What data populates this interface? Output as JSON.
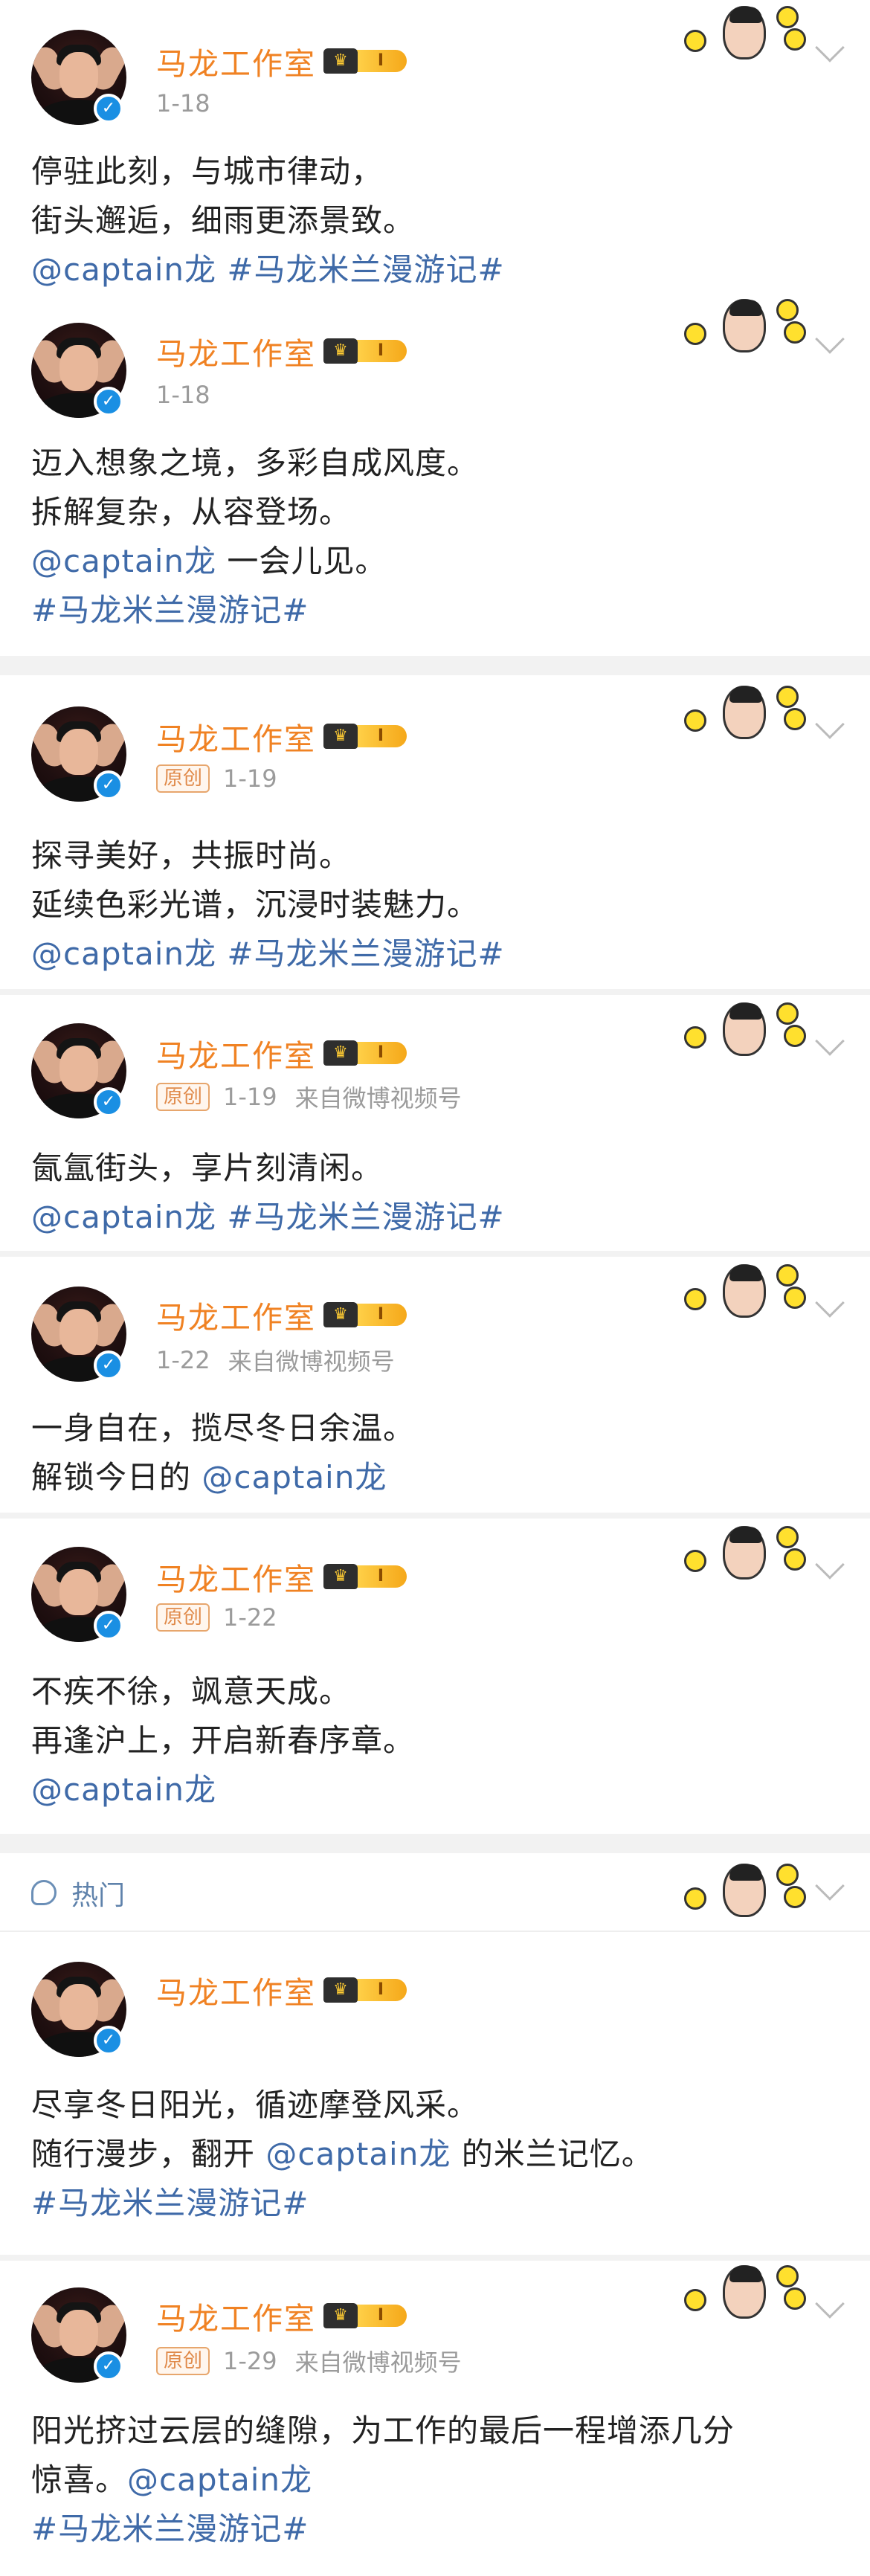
{
  "account": {
    "name": "马龙工作室",
    "vip_level": "Ⅰ",
    "verified_mark": "✓"
  },
  "labels": {
    "original": "原创",
    "hot": "热门"
  },
  "posts": [
    {
      "date": "1-18",
      "lines": [
        "停驻此刻，与城市律动，",
        "街头邂逅，细雨更添景致。",
        "@captain龙 #马龙米兰漫游记#"
      ]
    },
    {
      "date": "1-18",
      "lines": [
        "迈入想象之境，多彩自成风度。",
        "拆解复杂，从容登场。",
        "@captain龙 一会儿见。",
        "#马龙米兰漫游记#"
      ]
    },
    {
      "date": "1-19",
      "original": true,
      "lines": [
        "探寻美好，共振时尚。",
        "延续色彩光谱，沉浸时装魅力。",
        "@captain龙 #马龙米兰漫游记#"
      ]
    },
    {
      "date": "1-19",
      "original": true,
      "source": "来自微博视频号",
      "lines": [
        "氤氲街头，享片刻清闲。",
        "@captain龙 #马龙米兰漫游记#"
      ]
    },
    {
      "date": "1-22",
      "source": "来自微博视频号",
      "lines": [
        "一身自在，揽尽冬日余温。",
        "解锁今日的 @captain龙"
      ]
    },
    {
      "date": "1-22",
      "original": true,
      "lines": [
        "不疾不徐，飒意天成。",
        "再逢沪上，开启新春序章。",
        "@captain龙"
      ]
    },
    {
      "lines": [
        "尽享冬日阳光，循迹摩登风采。",
        "随行漫步，翻开 @captain龙 的米兰记忆。",
        "#马龙米兰漫游记#"
      ]
    },
    {
      "date": "1-29",
      "original": true,
      "source": "来自微博视频号",
      "lines": [
        "阳光挤过云层的缝隙，为工作的最后一程增添几分",
        "惊喜。@captain龙",
        "#马龙米兰漫游记#"
      ]
    }
  ]
}
